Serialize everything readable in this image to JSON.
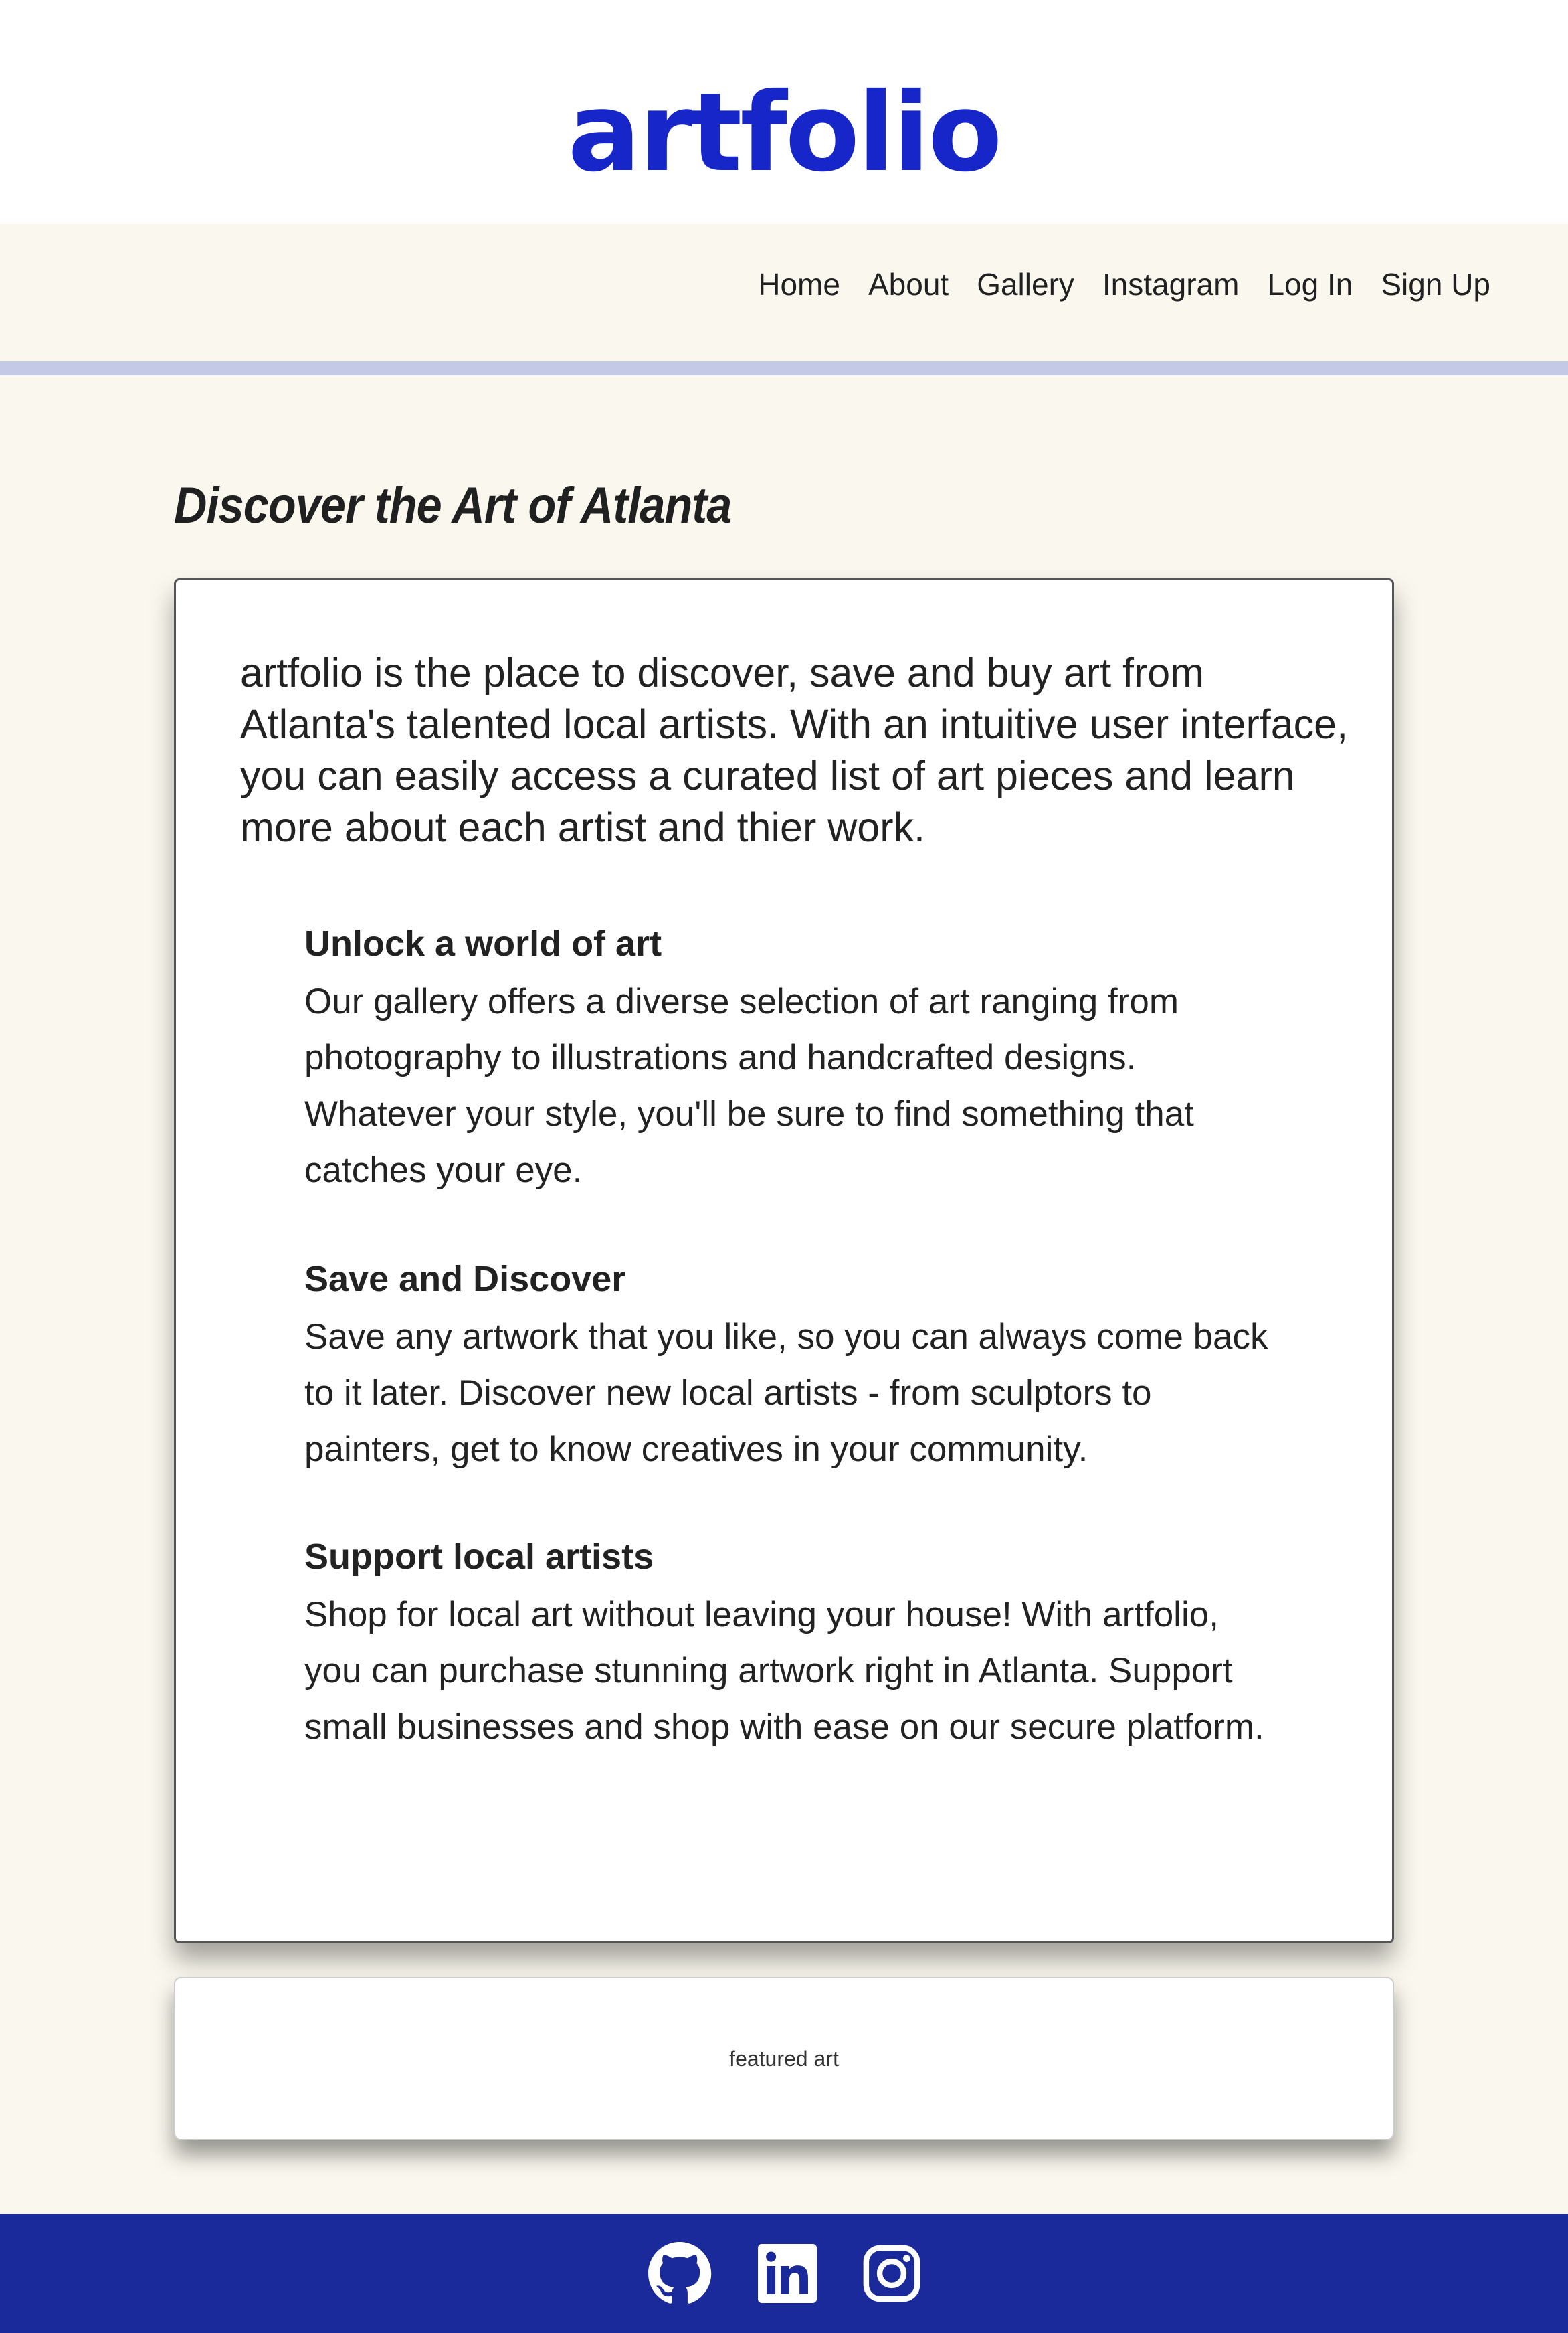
{
  "brand": {
    "logo_text": "artfolio",
    "logo_color": "#1726c8"
  },
  "nav": {
    "items": [
      {
        "label": "Home"
      },
      {
        "label": "About"
      },
      {
        "label": "Gallery"
      },
      {
        "label": "Instagram"
      },
      {
        "label": "Log In"
      },
      {
        "label": "Sign Up"
      }
    ]
  },
  "main": {
    "title": "Discover the Art of Atlanta",
    "intro": "artfolio is the place to discover, save and buy art from Atlanta's talented local artists. With an intuitive user interface, you can easily access a curated list of art pieces and learn more about each artist and thier work.",
    "features": [
      {
        "heading": "Unlock a world of art",
        "body": "Our gallery offers a diverse selection of art ranging from photography to illustrations and handcrafted designs. Whatever your style, you'll be sure to find something that catches your eye."
      },
      {
        "heading": "Save and Discover",
        "body": "Save any artwork that you like, so you can always come back to it later. Discover new local artists - from sculptors to painters, get to know creatives in your community."
      },
      {
        "heading": "Support local artists",
        "body": "Shop for local art without leaving your house! With artfolio, you can purchase stunning artwork right in Atlanta. Support small businesses and shop with ease on our secure platform."
      }
    ],
    "featured_label": "featured art"
  },
  "footer": {
    "background": "#1b2a9a",
    "icons": [
      "github-icon",
      "linkedin-icon",
      "instagram-icon"
    ]
  },
  "colors": {
    "page_background": "#faf8ee",
    "nav_rule": "#c4c9e5"
  }
}
